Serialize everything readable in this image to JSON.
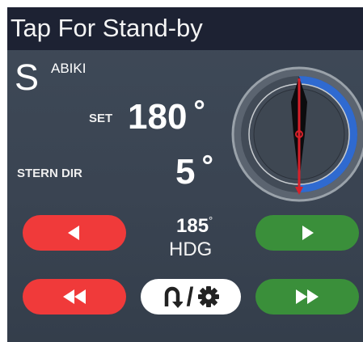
{
  "header": {
    "title": "Tap For Stand-by"
  },
  "mode": {
    "letter": "S",
    "name": "ABIKI"
  },
  "set": {
    "label": "SET",
    "value": "180",
    "unit": "°"
  },
  "stern": {
    "label": "STERN DIR",
    "value": "5",
    "unit": "°"
  },
  "heading": {
    "value": "185",
    "unit": "°",
    "label": "HDG"
  },
  "compass": {
    "bearing_deg": 180
  },
  "icons": {
    "port": "triangle-left-icon",
    "starboard": "triangle-right-icon",
    "port_fast": "double-arrow-left-icon",
    "starboard_fast": "double-arrow-right-icon",
    "turn": "u-turn-icon",
    "settings": "gear-icon"
  },
  "colors": {
    "port": "#f03a3a",
    "starboard": "#3a8f3a",
    "arc": "#2f6ad0",
    "needle": "#d8202a",
    "titlebar": "#1d2233"
  }
}
